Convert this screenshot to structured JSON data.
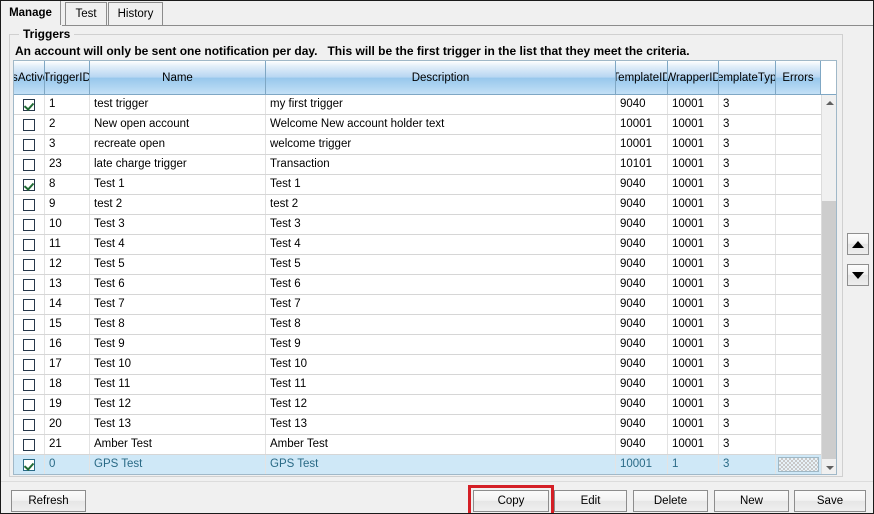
{
  "tabs": [
    {
      "label": "Manage",
      "active": true
    },
    {
      "label": "Test",
      "active": false
    },
    {
      "label": "History",
      "active": false
    }
  ],
  "groupbox": {
    "title": "Triggers",
    "instruction": "An account will only be sent one notification per day.   This will be the first trigger in the list that they meet the criteria."
  },
  "grid": {
    "columns": [
      {
        "key": "is_active",
        "label_line1": "Is",
        "label_line2": "Active"
      },
      {
        "key": "trigger_id",
        "label_line1": "Trigger",
        "label_line2": "ID"
      },
      {
        "key": "name",
        "label_line1": "Name",
        "label_line2": ""
      },
      {
        "key": "description",
        "label_line1": "Description",
        "label_line2": ""
      },
      {
        "key": "template_id",
        "label_line1": "Template",
        "label_line2": "ID"
      },
      {
        "key": "wrapper_id",
        "label_line1": "Wrapper",
        "label_line2": "ID"
      },
      {
        "key": "template_type",
        "label_line1": "Template",
        "label_line2": "Type"
      },
      {
        "key": "errors",
        "label_line1": "Errors",
        "label_line2": ""
      },
      {
        "key": "spacer",
        "label_line1": "",
        "label_line2": ""
      }
    ],
    "rows": [
      {
        "is_active": true,
        "trigger_id": "1",
        "name": "test trigger",
        "description": "my first trigger",
        "template_id": "9040",
        "wrapper_id": "10001",
        "template_type": "3",
        "errors": "",
        "selected": false
      },
      {
        "is_active": false,
        "trigger_id": "2",
        "name": "New open account",
        "description": "Welcome New account holder text",
        "template_id": "10001",
        "wrapper_id": "10001",
        "template_type": "3",
        "errors": "",
        "selected": false
      },
      {
        "is_active": false,
        "trigger_id": "3",
        "name": "recreate open",
        "description": "welcome trigger",
        "template_id": "10001",
        "wrapper_id": "10001",
        "template_type": "3",
        "errors": "",
        "selected": false
      },
      {
        "is_active": false,
        "trigger_id": "23",
        "name": "late charge trigger",
        "description": "Transaction",
        "template_id": "10101",
        "wrapper_id": "10001",
        "template_type": "3",
        "errors": "",
        "selected": false
      },
      {
        "is_active": true,
        "trigger_id": "8",
        "name": "Test 1",
        "description": "Test 1",
        "template_id": "9040",
        "wrapper_id": "10001",
        "template_type": "3",
        "errors": "",
        "selected": false
      },
      {
        "is_active": false,
        "trigger_id": "9",
        "name": "test 2",
        "description": "test 2",
        "template_id": "9040",
        "wrapper_id": "10001",
        "template_type": "3",
        "errors": "",
        "selected": false
      },
      {
        "is_active": false,
        "trigger_id": "10",
        "name": "Test 3",
        "description": "Test 3",
        "template_id": "9040",
        "wrapper_id": "10001",
        "template_type": "3",
        "errors": "",
        "selected": false
      },
      {
        "is_active": false,
        "trigger_id": "11",
        "name": "Test 4",
        "description": "Test 4",
        "template_id": "9040",
        "wrapper_id": "10001",
        "template_type": "3",
        "errors": "",
        "selected": false
      },
      {
        "is_active": false,
        "trigger_id": "12",
        "name": "Test 5",
        "description": "Test 5",
        "template_id": "9040",
        "wrapper_id": "10001",
        "template_type": "3",
        "errors": "",
        "selected": false
      },
      {
        "is_active": false,
        "trigger_id": "13",
        "name": "Test 6",
        "description": "Test 6",
        "template_id": "9040",
        "wrapper_id": "10001",
        "template_type": "3",
        "errors": "",
        "selected": false
      },
      {
        "is_active": false,
        "trigger_id": "14",
        "name": "Test 7",
        "description": "Test 7",
        "template_id": "9040",
        "wrapper_id": "10001",
        "template_type": "3",
        "errors": "",
        "selected": false
      },
      {
        "is_active": false,
        "trigger_id": "15",
        "name": "Test 8",
        "description": "Test 8",
        "template_id": "9040",
        "wrapper_id": "10001",
        "template_type": "3",
        "errors": "",
        "selected": false
      },
      {
        "is_active": false,
        "trigger_id": "16",
        "name": "Test 9",
        "description": "Test 9",
        "template_id": "9040",
        "wrapper_id": "10001",
        "template_type": "3",
        "errors": "",
        "selected": false
      },
      {
        "is_active": false,
        "trigger_id": "17",
        "name": "Test 10",
        "description": "Test 10",
        "template_id": "9040",
        "wrapper_id": "10001",
        "template_type": "3",
        "errors": "",
        "selected": false
      },
      {
        "is_active": false,
        "trigger_id": "18",
        "name": "Test 11",
        "description": "Test 11",
        "template_id": "9040",
        "wrapper_id": "10001",
        "template_type": "3",
        "errors": "",
        "selected": false
      },
      {
        "is_active": false,
        "trigger_id": "19",
        "name": "Test 12",
        "description": "Test 12",
        "template_id": "9040",
        "wrapper_id": "10001",
        "template_type": "3",
        "errors": "",
        "selected": false
      },
      {
        "is_active": false,
        "trigger_id": "20",
        "name": "Test 13",
        "description": "Test 13",
        "template_id": "9040",
        "wrapper_id": "10001",
        "template_type": "3",
        "errors": "",
        "selected": false
      },
      {
        "is_active": false,
        "trigger_id": "21",
        "name": "Amber Test",
        "description": "Amber Test",
        "template_id": "9040",
        "wrapper_id": "10001",
        "template_type": "3",
        "errors": "",
        "selected": false
      },
      {
        "is_active": true,
        "trigger_id": "0",
        "name": "GPS Test",
        "description": "GPS Test",
        "template_id": "10001",
        "wrapper_id": "1",
        "template_type": "3",
        "errors": "",
        "selected": true
      }
    ]
  },
  "reorder": {
    "up_icon": "triangle-up-icon",
    "down_icon": "triangle-down-icon"
  },
  "scrollbar": {
    "up_icon": "chevron-up-icon",
    "down_icon": "chevron-down-icon"
  },
  "buttons": {
    "refresh": "Refresh",
    "copy": "Copy",
    "edit": "Edit",
    "delete": "Delete",
    "new": "New",
    "save": "Save"
  },
  "highlight": {
    "target": "copy",
    "color": "#d41f26"
  }
}
